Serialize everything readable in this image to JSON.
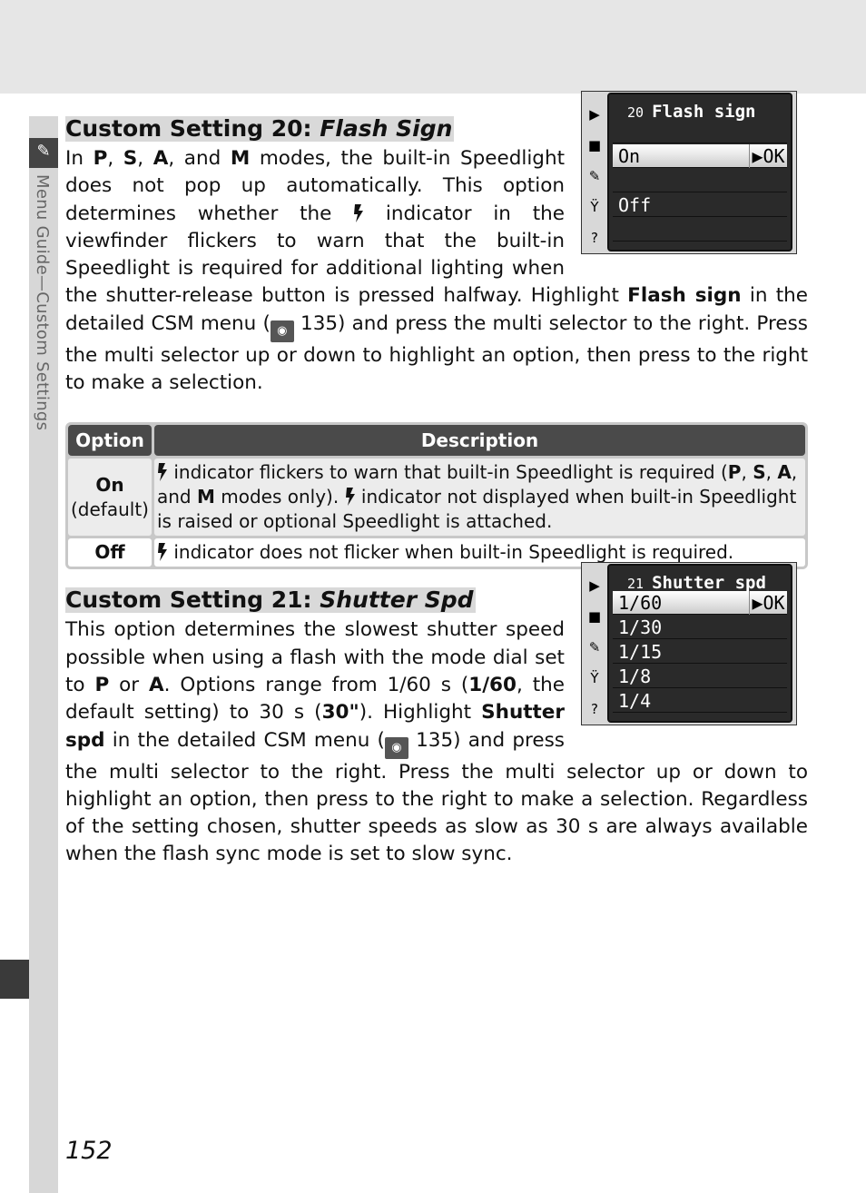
{
  "sidebar": {
    "text": "Menu Guide—Custom Settings",
    "icon": "pencil-icon"
  },
  "sections": [
    {
      "number": "Custom Setting 20: ",
      "name": "Flash Sign",
      "paragraph": [
        {
          "t": "In "
        },
        {
          "t": "P",
          "b": 1
        },
        {
          "t": ", "
        },
        {
          "t": "S",
          "b": 1
        },
        {
          "t": ", "
        },
        {
          "t": "A",
          "b": 1
        },
        {
          "t": ", and "
        },
        {
          "t": "M",
          "b": 1
        },
        {
          "t": " modes, the built-in Speedlight does not pop up automatically.  This option determines whether the "
        },
        {
          "icon": "flash"
        },
        {
          "t": " indicator in the viewfinder flickers to warn that the built-in Speedlight is required for additional lighting when the shutter-release button is pressed halfway.  Highlight "
        },
        {
          "t": "Flash sign",
          "b": 1
        },
        {
          "t": " in the detailed CSM menu ("
        },
        {
          "icon": "page"
        },
        {
          "t": " 135) and press the multi selector to the right.  Press the multi selector up or down to highlight an option, then press to the right to make a selection."
        }
      ],
      "screen": {
        "num": "20",
        "title": "Flash sign",
        "rows": [
          "",
          "On",
          "",
          "Off",
          ""
        ],
        "selected": 1,
        "ok": "▶OK"
      }
    },
    {
      "number": "Custom Setting 21: ",
      "name": "Shutter Spd",
      "paragraph": [
        {
          "t": "This option determines the slowest shutter speed possible when using a flash with the mode dial set to "
        },
        {
          "t": "P",
          "b": 1
        },
        {
          "t": " or "
        },
        {
          "t": "A",
          "b": 1
        },
        {
          "t": ".  Options range from 1/60 s ("
        },
        {
          "t": "1/60",
          "b": 1
        },
        {
          "t": ", the default setting) to 30 s ("
        },
        {
          "t": "30\"",
          "b": 1
        },
        {
          "t": ").  Highlight "
        },
        {
          "t": "Shutter spd",
          "b": 1
        },
        {
          "t": " in the detailed CSM menu ("
        },
        {
          "icon": "page"
        },
        {
          "t": " 135) and press the multi selector to the right.  Press the multi selector up or down to highlight an option, then press to the right to make a selection.  Regardless of the setting chosen, shutter speeds as slow as 30 s are always available when the flash sync mode is set to slow sync."
        }
      ],
      "screen": {
        "num": "21",
        "title": "Shutter spd",
        "rows": [
          "1/60",
          "1/30",
          "1/15",
          "1/8",
          "1/4"
        ],
        "selected": 0,
        "ok": "▶OK"
      }
    }
  ],
  "table": {
    "headers": [
      "Option",
      "Description"
    ],
    "rows": [
      {
        "option": "On",
        "sub": "(default)",
        "desc": [
          {
            "icon": "flash"
          },
          {
            "t": " indicator flickers to warn that built-in Speedlight is required ("
          },
          {
            "t": "P",
            "b": 1
          },
          {
            "t": ", "
          },
          {
            "t": "S",
            "b": 1
          },
          {
            "t": ", "
          },
          {
            "t": "A",
            "b": 1
          },
          {
            "t": ", and "
          },
          {
            "t": "M",
            "b": 1
          },
          {
            "t": " modes only).  "
          },
          {
            "icon": "flash"
          },
          {
            "t": " indicator not displayed when built-in Speedlight is raised or optional Speedlight is attached."
          }
        ]
      },
      {
        "option": "Off",
        "desc": [
          {
            "icon": "flash"
          },
          {
            "t": " indicator does not flicker when built-in Speedlight is required."
          }
        ]
      }
    ]
  },
  "page_number": "152",
  "screen_side_icons": [
    "▶",
    "■",
    "✎",
    "Ÿ",
    "?"
  ]
}
